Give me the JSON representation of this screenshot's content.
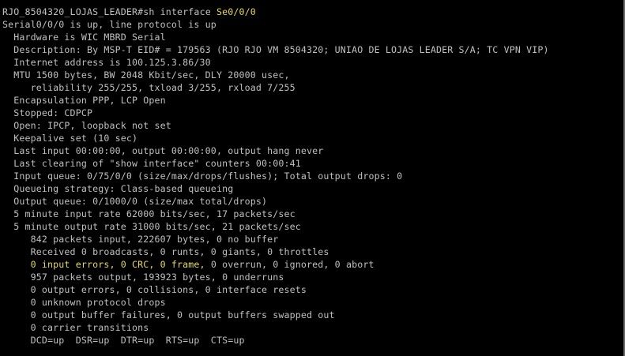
{
  "colors": {
    "background": "#000000",
    "text": "#c0c0c0",
    "highlight": "#e6d75a"
  },
  "prompt": {
    "hostname_prompt": "RJO_8504320_LOJAS_LEADER#",
    "command": "sh interface ",
    "interface_arg": "Se0/0/0"
  },
  "output": {
    "l01": "Serial0/0/0 is up, line protocol is up",
    "l02": "  Hardware is WIC MBRD Serial",
    "l03": "  Description: By MSP-T EID# = 179563 (RJO RJO VM 8504320; UNIAO DE LOJAS LEADER S/A; TC VPN VIP)",
    "l04": "  Internet address is 100.125.3.86/30",
    "l05": "  MTU 1500 bytes, BW 2048 Kbit/sec, DLY 20000 usec,",
    "l06": "     reliability 255/255, txload 3/255, rxload 7/255",
    "l07": "  Encapsulation PPP, LCP Open",
    "l08": "  Stopped: CDPCP",
    "l09": "  Open: IPCP, loopback not set",
    "l10": "  Keepalive set (10 sec)",
    "l11": "  Last input 00:00:00, output 00:00:00, output hang never",
    "l12": "  Last clearing of \"show interface\" counters 00:00:41",
    "l13": "  Input queue: 0/75/0/0 (size/max/drops/flushes); Total output drops: 0",
    "l14": "  Queueing strategy: Class-based queueing",
    "l15": "  Output queue: 0/1000/0 (size/max total/drops)",
    "l16": "  5 minute input rate 62000 bits/sec, 17 packets/sec",
    "l17": "  5 minute output rate 31000 bits/sec, 21 packets/sec",
    "l18": "     842 packets input, 222607 bytes, 0 no buffer",
    "l19": "     Received 0 broadcasts, 0 runts, 0 giants, 0 throttles",
    "l20_highlight": "     0 input errors, 0 CRC, 0 frame,",
    "l20_rest": " 0 overrun, 0 ignored, 0 abort",
    "l21": "     957 packets output, 193923 bytes, 0 underruns",
    "l22": "     0 output errors, 0 collisions, 0 interface resets",
    "l23": "     0 unknown protocol drops",
    "l24": "     0 output buffer failures, 0 output buffers swapped out",
    "l25": "     0 carrier transitions",
    "l26": "     DCD=up  DSR=up  DTR=up  RTS=up  CTS=up"
  }
}
